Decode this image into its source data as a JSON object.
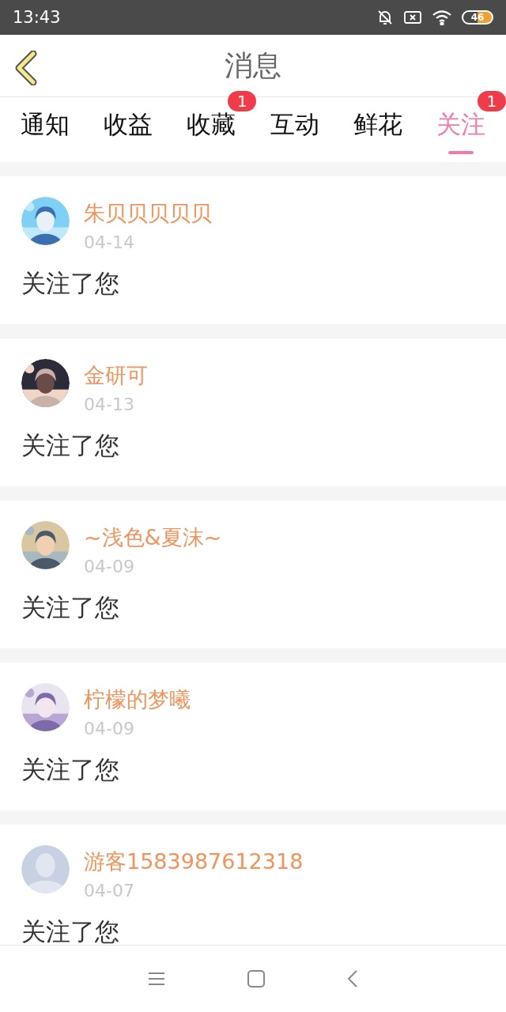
{
  "status_bar": {
    "time": "13:43",
    "battery": "46"
  },
  "header": {
    "title": "消息"
  },
  "tabs": [
    {
      "label": "通知",
      "selected": false
    },
    {
      "label": "收益",
      "selected": false
    },
    {
      "label": "收藏",
      "selected": false,
      "badge": "1"
    },
    {
      "label": "互动",
      "selected": false
    },
    {
      "label": "鲜花",
      "selected": false
    },
    {
      "label": "关注",
      "selected": true,
      "badge": "1"
    }
  ],
  "messages": [
    {
      "name": "朱贝贝贝贝贝",
      "date": "04-14",
      "text": "关注了您"
    },
    {
      "name": "金研可",
      "date": "04-13",
      "text": "关注了您"
    },
    {
      "name": "~浅色&夏沫~",
      "date": "04-09",
      "text": "关注了您"
    },
    {
      "name": "柠檬的梦曦",
      "date": "04-09",
      "text": "关注了您"
    },
    {
      "avatar": {
        "kind": "default"
      },
      "name": "游客1583987612318",
      "date": "04-07",
      "text": "关注了您"
    }
  ]
}
